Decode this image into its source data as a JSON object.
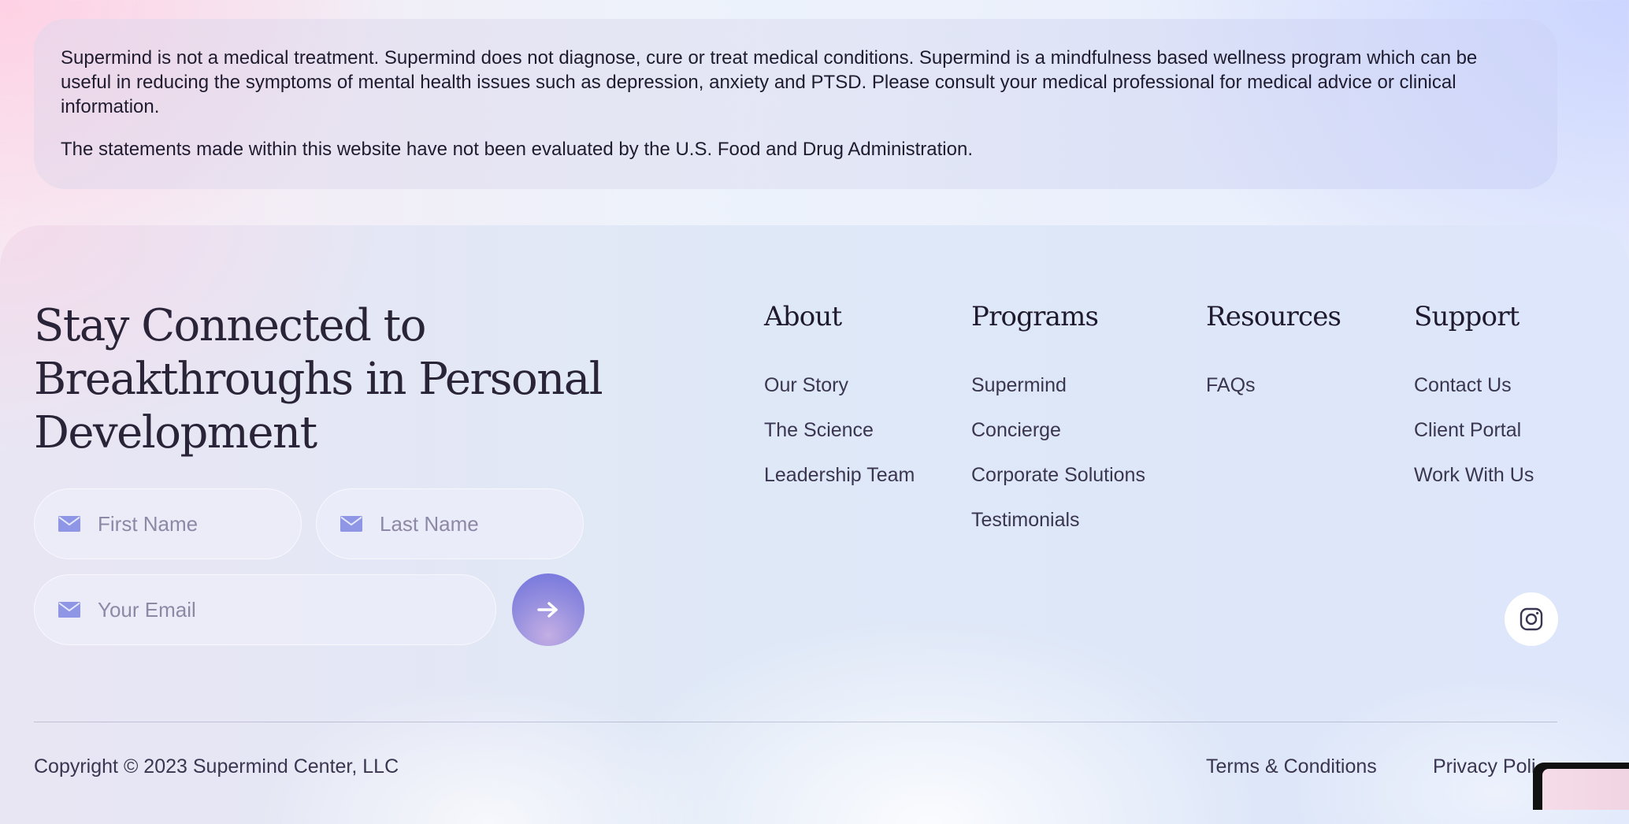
{
  "disclaimer": {
    "paragraph1": "Supermind is not a medical treatment. Supermind does not diagnose, cure or treat medical conditions. Supermind is a mindfulness based wellness program which can be useful in reducing the symptoms of mental health issues such as depression, anxiety and PTSD. Please consult your medical professional for medical advice or clinical information.",
    "paragraph2": "The statements made within this website have not been evaluated by the U.S. Food and Drug Administration."
  },
  "newsletter": {
    "headline": "Stay Connected to Breakthroughs in Personal Development",
    "first_name_placeholder": "First Name",
    "last_name_placeholder": "Last Name",
    "email_placeholder": "Your Email",
    "field_icon": "mail-icon",
    "submit_icon": "arrow-right-icon"
  },
  "columns": {
    "about": {
      "title": "About",
      "links": [
        "Our Story",
        "The Science",
        "Leadership Team"
      ]
    },
    "programs": {
      "title": "Programs",
      "links": [
        "Supermind",
        "Concierge",
        "Corporate Solutions",
        "Testimonials"
      ]
    },
    "resources": {
      "title": "Resources",
      "links": [
        "FAQs"
      ]
    },
    "support": {
      "title": "Support",
      "links": [
        "Contact Us",
        "Client Portal",
        "Work With Us"
      ]
    }
  },
  "social": {
    "instagram_icon": "instagram-icon"
  },
  "bottom": {
    "copyright": "Copyright © 2023 Supermind Center, LLC",
    "terms": "Terms & Conditions",
    "privacy": "Privacy Poli"
  },
  "colors": {
    "accent": "#7b7fe0",
    "text": "#1f1c30",
    "muted_text": "#3a3550",
    "placeholder": "#8c88a6"
  }
}
